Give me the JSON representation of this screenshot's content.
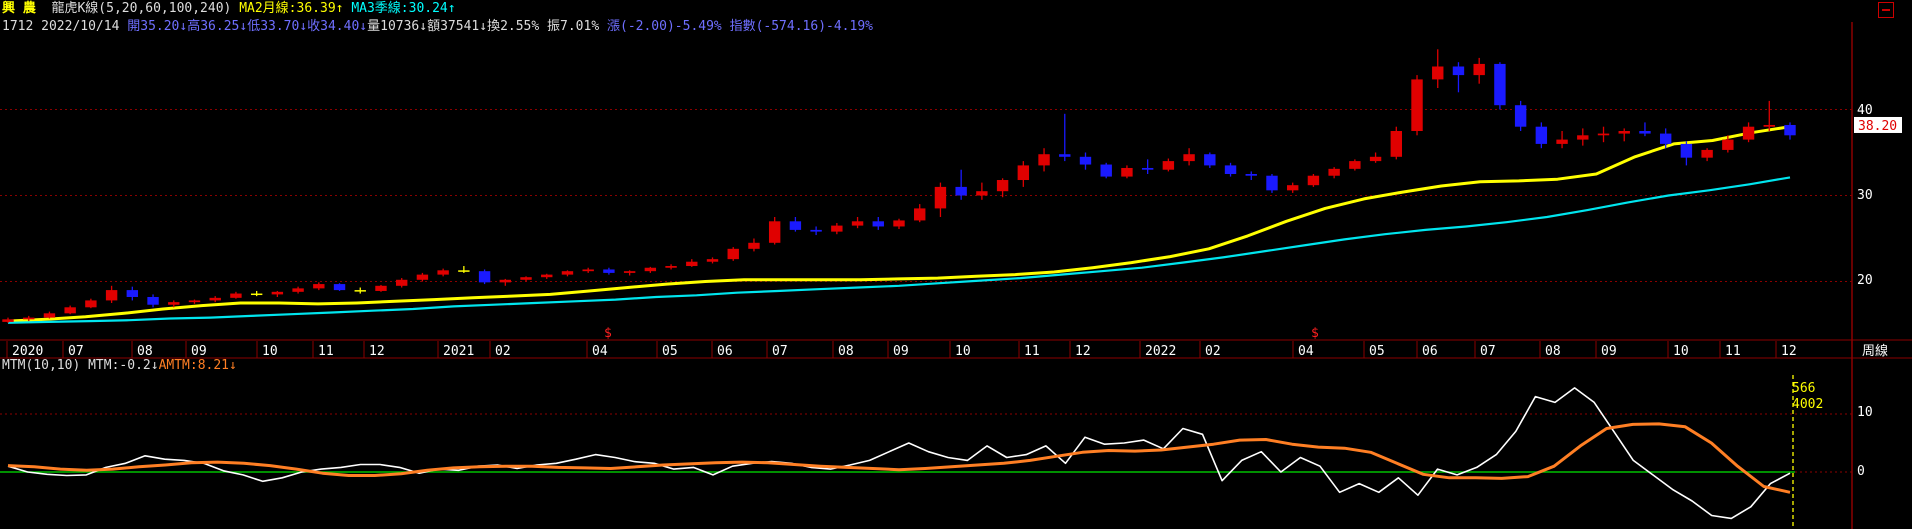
{
  "header": {
    "symbol": "興 農",
    "indicator_title": "龍虎K線(5,20,60,100,240)",
    "ma2_label": "MA2月線:36.39↑",
    "ma3_label": "MA3季線:30.24↑",
    "code": "1712",
    "date": "2022/10/14",
    "open_label": "開35.20↓",
    "high_label": "高36.25↓",
    "low_label": "低33.70↓",
    "close_label": "收34.40↓",
    "volume_label": "量10736↓",
    "amount_label": "額37541↓",
    "turnover_label": "換2.55%",
    "amplitude_label": "振7.01%",
    "change_label": "漲(-2.00)-5.49%",
    "index_label": "指數(-574.16)-4.19%"
  },
  "price_axis": {
    "ticks": [
      "40",
      "30",
      "20"
    ],
    "current_price": "38.20",
    "period_label": "周線"
  },
  "time_axis": {
    "ticks": [
      "2020",
      "07",
      "08",
      "09",
      "10",
      "11",
      "12",
      "2021",
      "02",
      "04",
      "05",
      "06",
      "07",
      "08",
      "09",
      "10",
      "11",
      "12",
      "2022",
      "02",
      "04",
      "05",
      "06",
      "07",
      "08",
      "09",
      "10",
      "11",
      "12"
    ],
    "markers": [
      "$",
      "$"
    ]
  },
  "mtm": {
    "label": "MTM(10,10)",
    "mtm_value": "MTM:-0.2↓",
    "amtm_value": "AMTM:8.21↓",
    "ticks": [
      "10",
      "0"
    ],
    "cursor_values": [
      "566",
      "4002"
    ]
  },
  "colors": {
    "up": "#e00000",
    "down": "#1a1aff",
    "doji": "#ffff00",
    "ma_month": "#ffff00",
    "ma_quarter": "#00e5ee",
    "mtm": "#ffffff",
    "amtm": "#ff7f24",
    "zero": "#00c000",
    "grid": "#8b0000"
  },
  "chart_data": [
    {
      "type": "candlestick",
      "title": "龍虎K線(5,20,60,100,240)",
      "ylim": [
        15.5,
        45
      ],
      "series": [
        {
          "name": "MA2月線",
          "values": [
            15.4,
            15.6,
            15.9,
            16.3,
            16.8,
            17.2,
            17.5,
            17.5,
            17.4,
            17.5,
            17.7,
            17.9,
            18.1,
            18.3,
            18.5,
            18.9,
            19.3,
            19.7,
            20.0,
            20.2,
            20.2,
            20.2,
            20.2,
            20.3,
            20.4,
            20.6,
            20.8,
            21.1,
            21.6,
            22.2,
            22.9,
            23.8,
            25.3,
            27.0,
            28.5,
            29.6,
            30.4,
            31.1,
            31.6,
            31.7,
            31.9,
            32.5,
            34.5,
            36.0,
            36.4,
            37.3,
            38.0
          ]
        },
        {
          "name": "MA3季線",
          "values": [
            15.2,
            15.3,
            15.4,
            15.5,
            15.7,
            15.8,
            16.0,
            16.2,
            16.4,
            16.6,
            16.8,
            17.1,
            17.3,
            17.5,
            17.7,
            17.9,
            18.2,
            18.4,
            18.7,
            18.9,
            19.1,
            19.3,
            19.5,
            19.8,
            20.1,
            20.4,
            20.8,
            21.2,
            21.6,
            22.2,
            22.8,
            23.5,
            24.2,
            24.9,
            25.5,
            26.0,
            26.4,
            26.9,
            27.5,
            28.3,
            29.2,
            30.0,
            30.6,
            31.3,
            32.1
          ]
        }
      ],
      "candles": [
        [
          15.3,
          15.8,
          15.2,
          15.6
        ],
        [
          15.6,
          16.0,
          15.4,
          15.8
        ],
        [
          15.8,
          16.5,
          15.7,
          16.3
        ],
        [
          16.3,
          17.2,
          16.2,
          17.0
        ],
        [
          17.0,
          18.0,
          16.9,
          17.8
        ],
        [
          17.8,
          19.5,
          17.5,
          19.0
        ],
        [
          19.0,
          19.4,
          17.8,
          18.2
        ],
        [
          18.2,
          18.5,
          17.0,
          17.3
        ],
        [
          17.3,
          17.8,
          17.0,
          17.6
        ],
        [
          17.6,
          17.9,
          17.4,
          17.8
        ],
        [
          17.8,
          18.3,
          17.6,
          18.1
        ],
        [
          18.1,
          18.8,
          18.0,
          18.6
        ],
        [
          18.6,
          18.9,
          18.3,
          18.5
        ],
        [
          18.5,
          18.9,
          18.2,
          18.8
        ],
        [
          18.8,
          19.4,
          18.6,
          19.2
        ],
        [
          19.2,
          19.9,
          19.0,
          19.7
        ],
        [
          19.7,
          19.8,
          18.9,
          19.0
        ],
        [
          19.0,
          19.3,
          18.6,
          18.9
        ],
        [
          18.9,
          19.6,
          18.8,
          19.5
        ],
        [
          19.5,
          20.4,
          19.3,
          20.2
        ],
        [
          20.2,
          21.0,
          20.0,
          20.8
        ],
        [
          20.8,
          21.5,
          20.6,
          21.3
        ],
        [
          21.3,
          21.8,
          21.0,
          21.2
        ],
        [
          21.2,
          21.4,
          19.7,
          19.9
        ],
        [
          19.9,
          20.3,
          19.5,
          20.2
        ],
        [
          20.2,
          20.6,
          20.0,
          20.5
        ],
        [
          20.5,
          20.9,
          20.3,
          20.8
        ],
        [
          20.8,
          21.3,
          20.6,
          21.2
        ],
        [
          21.2,
          21.6,
          21.0,
          21.4
        ],
        [
          21.4,
          21.6,
          20.8,
          21.0
        ],
        [
          21.0,
          21.3,
          20.7,
          21.2
        ],
        [
          21.2,
          21.7,
          21.0,
          21.6
        ],
        [
          21.6,
          22.0,
          21.4,
          21.8
        ],
        [
          21.8,
          22.6,
          21.7,
          22.3
        ],
        [
          22.3,
          22.8,
          22.1,
          22.6
        ],
        [
          22.6,
          24.0,
          22.4,
          23.8
        ],
        [
          23.8,
          25.0,
          23.5,
          24.5
        ],
        [
          24.5,
          27.5,
          24.3,
          27.0
        ],
        [
          27.0,
          27.5,
          25.8,
          26.0
        ],
        [
          26.0,
          26.4,
          25.4,
          25.8
        ],
        [
          25.8,
          26.8,
          25.5,
          26.5
        ],
        [
          26.5,
          27.5,
          26.2,
          27.0
        ],
        [
          27.0,
          27.5,
          26.0,
          26.4
        ],
        [
          26.4,
          27.3,
          26.1,
          27.1
        ],
        [
          27.1,
          29.0,
          26.9,
          28.5
        ],
        [
          28.5,
          31.5,
          27.5,
          31.0
        ],
        [
          31.0,
          33.0,
          29.5,
          30.0
        ],
        [
          30.0,
          31.5,
          29.5,
          30.5
        ],
        [
          30.5,
          32.0,
          29.8,
          31.8
        ],
        [
          31.8,
          34.0,
          31.0,
          33.5
        ],
        [
          33.5,
          35.5,
          32.8,
          34.8
        ],
        [
          34.8,
          39.5,
          34.0,
          34.5
        ],
        [
          34.5,
          35.0,
          33.0,
          33.6
        ],
        [
          33.6,
          33.8,
          32.0,
          32.2
        ],
        [
          32.2,
          33.5,
          32.0,
          33.2
        ],
        [
          33.2,
          34.2,
          32.5,
          33.0
        ],
        [
          33.0,
          34.3,
          32.8,
          34.0
        ],
        [
          34.0,
          35.5,
          33.5,
          34.8
        ],
        [
          34.8,
          35.0,
          33.2,
          33.5
        ],
        [
          33.5,
          33.8,
          32.2,
          32.5
        ],
        [
          32.5,
          32.8,
          31.8,
          32.3
        ],
        [
          32.3,
          32.5,
          30.3,
          30.6
        ],
        [
          30.6,
          31.5,
          30.3,
          31.2
        ],
        [
          31.2,
          32.5,
          31.0,
          32.3
        ],
        [
          32.3,
          33.3,
          32.0,
          33.1
        ],
        [
          33.1,
          34.2,
          32.9,
          34.0
        ],
        [
          34.0,
          35.0,
          33.8,
          34.5
        ],
        [
          34.5,
          38.0,
          34.2,
          37.5
        ],
        [
          37.5,
          44.0,
          37.0,
          43.5
        ],
        [
          43.5,
          47.0,
          42.5,
          45.0
        ],
        [
          45.0,
          45.5,
          42.0,
          44.0
        ],
        [
          44.0,
          46.0,
          43.0,
          45.3
        ],
        [
          45.3,
          45.5,
          40.0,
          40.5
        ],
        [
          40.5,
          41.0,
          37.5,
          38.0
        ],
        [
          38.0,
          38.5,
          35.5,
          36.0
        ],
        [
          36.0,
          37.5,
          35.5,
          36.5
        ],
        [
          36.5,
          37.8,
          35.8,
          37.0
        ],
        [
          37.0,
          38.0,
          36.2,
          37.2
        ],
        [
          37.2,
          37.8,
          36.3,
          37.5
        ],
        [
          37.5,
          38.5,
          36.9,
          37.2
        ],
        [
          37.2,
          37.8,
          35.5,
          36.0
        ],
        [
          36.0,
          36.3,
          33.5,
          34.4
        ],
        [
          34.4,
          35.5,
          34.0,
          35.3
        ],
        [
          35.3,
          37.0,
          35.0,
          36.5
        ],
        [
          36.5,
          38.5,
          36.2,
          38.0
        ],
        [
          38.0,
          41.0,
          37.5,
          38.2
        ],
        [
          38.2,
          38.5,
          36.5,
          37.0
        ]
      ],
      "ytick_values": [
        40,
        30,
        20
      ],
      "current_price": 38.2
    },
    {
      "type": "line",
      "title": "MTM(10,10)",
      "ylim": [
        -9,
        16
      ],
      "series": [
        {
          "name": "MTM",
          "values": [
            1.0,
            0.0,
            -0.4,
            -0.6,
            -0.5,
            0.8,
            1.5,
            2.8,
            2.2,
            2.0,
            1.5,
            0.2,
            -0.5,
            -1.6,
            -1.0,
            0.0,
            0.5,
            0.8,
            1.3,
            1.3,
            0.8,
            -0.2,
            0.5,
            0.3,
            1.0,
            1.2,
            0.6,
            1.2,
            1.5,
            2.2,
            3.0,
            2.5,
            1.8,
            1.5,
            0.5,
            0.8,
            -0.5,
            1.0,
            1.5,
            1.8,
            1.5,
            0.8,
            0.5,
            1.2,
            2.0,
            3.5,
            5.0,
            3.5,
            2.5,
            2.0,
            4.5,
            2.5,
            3.0,
            4.5,
            1.5,
            6.0,
            4.8,
            5.0,
            5.5,
            4.0,
            7.5,
            6.5,
            -1.5,
            2.0,
            3.5,
            0.0,
            2.5,
            1.0,
            -3.5,
            -2.0,
            -3.5,
            -1.0,
            -4.0,
            0.5,
            -0.5,
            0.8,
            3.0,
            7.0,
            13.0,
            12.0,
            14.5,
            12.0,
            7.0,
            2.0,
            -0.5,
            -3.0,
            -5.0,
            -7.5,
            -8.0,
            -6.0,
            -2.0,
            -0.2
          ]
        },
        {
          "name": "AMTM",
          "values": [
            1.1,
            0.9,
            0.5,
            0.3,
            0.5,
            0.9,
            1.2,
            1.6,
            1.7,
            1.5,
            1.1,
            0.5,
            -0.2,
            -0.6,
            -0.6,
            -0.3,
            0.3,
            0.7,
            0.9,
            1.0,
            1.0,
            0.8,
            0.7,
            0.6,
            0.9,
            1.2,
            1.4,
            1.6,
            1.7,
            1.6,
            1.3,
            1.0,
            0.8,
            0.6,
            0.4,
            0.6,
            0.9,
            1.2,
            1.5,
            2.0,
            2.7,
            3.4,
            3.7,
            3.6,
            3.8,
            4.3,
            4.8,
            5.5,
            5.6,
            4.8,
            4.3,
            4.1,
            3.4,
            1.5,
            -0.4,
            -1.0,
            -1.0,
            -1.1,
            -0.8,
            1.0,
            4.5,
            7.5,
            8.2,
            8.3,
            7.8,
            5.0,
            1.0,
            -2.5,
            -3.5
          ]
        }
      ],
      "ytick_values": [
        10,
        0
      ]
    }
  ]
}
